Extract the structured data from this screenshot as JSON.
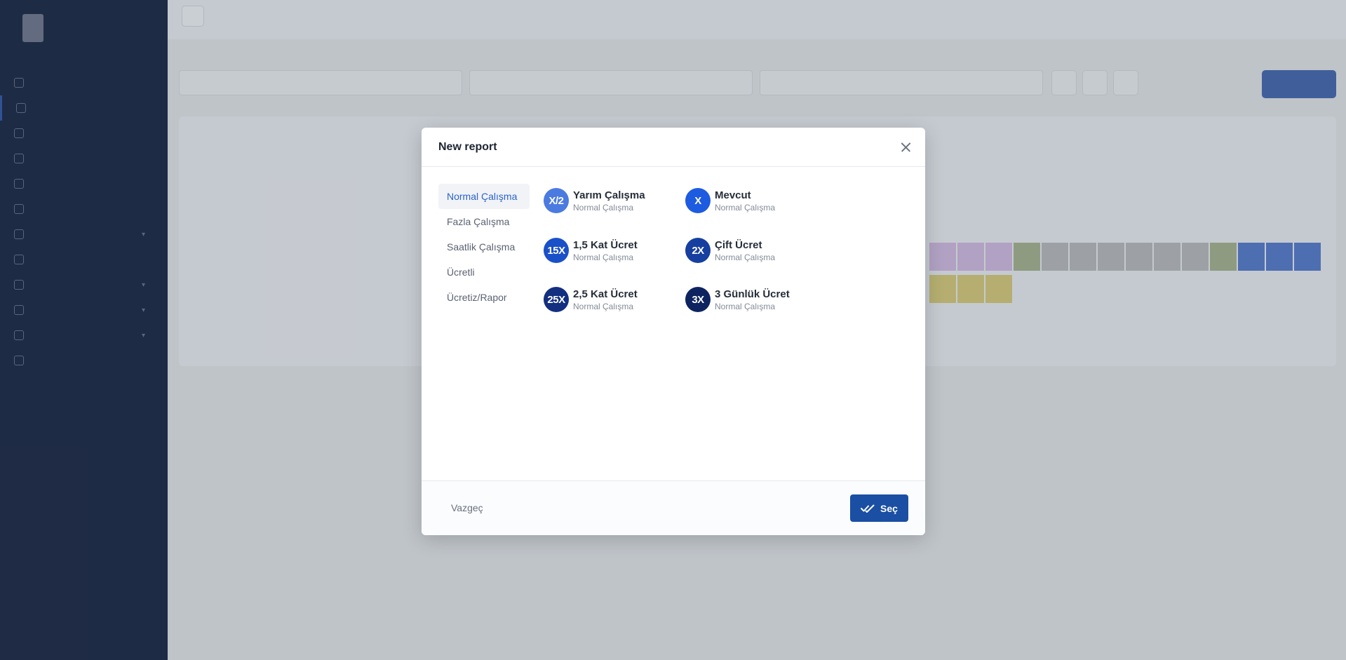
{
  "modal": {
    "title": "New report",
    "tabs": [
      {
        "label": "Normal Çalışma",
        "active": true
      },
      {
        "label": "Fazla Çalışma",
        "active": false
      },
      {
        "label": "Saatlik Çalışma",
        "active": false
      },
      {
        "label": "Ücretli",
        "active": false
      },
      {
        "label": "Ücretiz/Rapor",
        "active": false
      }
    ],
    "options": [
      {
        "badge": "X/2",
        "title": "Yarım Çalışma",
        "subtitle": "Normal Çalışma",
        "color": "#4b7be0"
      },
      {
        "badge": "X",
        "title": "Mevcut",
        "subtitle": "Normal Çalışma",
        "color": "#1d5be0"
      },
      {
        "badge": "15X",
        "title": "1,5 Kat Ücret",
        "subtitle": "Normal Çalışma",
        "color": "#1a50c8"
      },
      {
        "badge": "2X",
        "title": "Çift Ücret",
        "subtitle": "Normal Çalışma",
        "color": "#163fa0"
      },
      {
        "badge": "25X",
        "title": "2,5 Kat Ücret",
        "subtitle": "Normal Çalışma",
        "color": "#122f80"
      },
      {
        "badge": "3X",
        "title": "3 Günlük Ücret",
        "subtitle": "Normal Çalışma",
        "color": "#0e2460"
      }
    ],
    "cancel_label": "Vazgeç",
    "select_label": "Seç"
  },
  "colors": {
    "sidebar_bg": "#1a2640",
    "primary": "#1a4fa3"
  }
}
